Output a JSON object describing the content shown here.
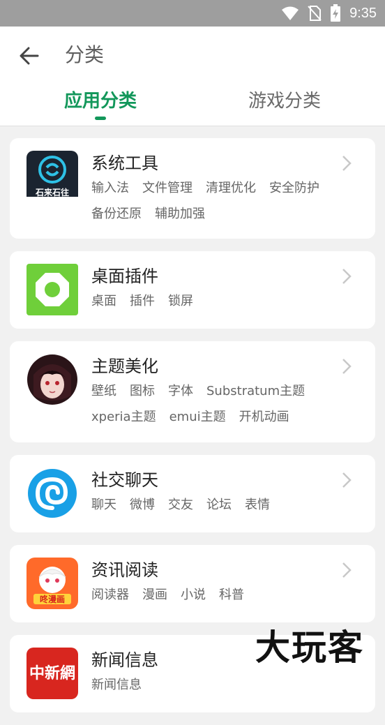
{
  "status_bar": {
    "time": "9:35"
  },
  "header": {
    "title": "分类"
  },
  "tabs": [
    {
      "label": "应用分类",
      "active": true
    },
    {
      "label": "游戏分类",
      "active": false
    }
  ],
  "categories": [
    {
      "title": "系统工具",
      "icon": "shilaishiwang-app-icon",
      "tags": [
        "输入法",
        "文件管理",
        "清理优化",
        "安全防护",
        "备份还原",
        "辅助加强"
      ],
      "icon_text": "石来石往"
    },
    {
      "title": "桌面插件",
      "icon": "octagon-widget-icon",
      "tags": [
        "桌面",
        "插件",
        "锁屏"
      ]
    },
    {
      "title": "主题美化",
      "icon": "anime-avatar-icon",
      "tags": [
        "壁纸",
        "图标",
        "字体",
        "Substratum主题",
        "xperia主题",
        "emui主题",
        "开机动画"
      ]
    },
    {
      "title": "社交聊天",
      "icon": "spiral-chat-icon",
      "tags": [
        "聊天",
        "微博",
        "交友",
        "论坛",
        "表情"
      ]
    },
    {
      "title": "资讯阅读",
      "icon": "manga-reader-icon",
      "tags": [
        "阅读器",
        "漫画",
        "小说",
        "科普"
      ],
      "icon_text": "咚漫画"
    },
    {
      "title": "新闻信息",
      "icon": "chinanews-icon",
      "tags": [
        "新闻信息"
      ],
      "icon_text": "中新網"
    }
  ],
  "watermark": "大玩客",
  "colors": {
    "accent": "#12975a",
    "status_bar": "#9e9e9e",
    "background": "#f1f1f1"
  }
}
